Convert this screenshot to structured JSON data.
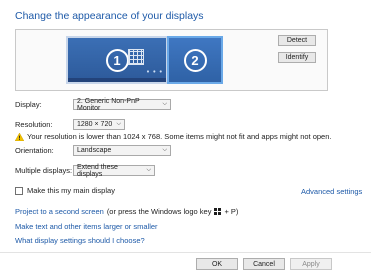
{
  "title": "Change the appearance of your displays",
  "preview": {
    "monitor1_number": "1",
    "monitor2_number": "2",
    "dots": "• • •",
    "detect_label": "Detect",
    "identify_label": "Identify"
  },
  "display": {
    "label": "Display:",
    "value": "2. Generic Non-PnP Monitor"
  },
  "resolution": {
    "label": "Resolution:",
    "value": "1280 × 720"
  },
  "warning": "Your resolution is lower than 1024 x 768. Some items might not fit and apps might not open.",
  "orientation": {
    "label": "Orientation:",
    "value": "Landscape"
  },
  "multiple_displays": {
    "label": "Multiple displays:",
    "value": "Extend these displays"
  },
  "main_display": {
    "label": "Make this my main display",
    "checked": false
  },
  "advanced_settings": "Advanced settings",
  "links": {
    "project_link": "Project to a second screen",
    "project_suffix": "(or press the Windows logo key",
    "project_key": "+ P)",
    "text_size": "Make text and other items larger or smaller",
    "help": "What display settings should I choose?"
  },
  "footer": {
    "ok": "OK",
    "cancel": "Cancel",
    "apply": "Apply"
  },
  "colors": {
    "accent": "#1e5aa8",
    "monitor": "#2d5a9a",
    "selected_border": "#6aa9e8"
  },
  "icons": {
    "warning": "warning-icon",
    "windows": "windows-logo-icon",
    "chevron": "chevron-down-icon"
  }
}
